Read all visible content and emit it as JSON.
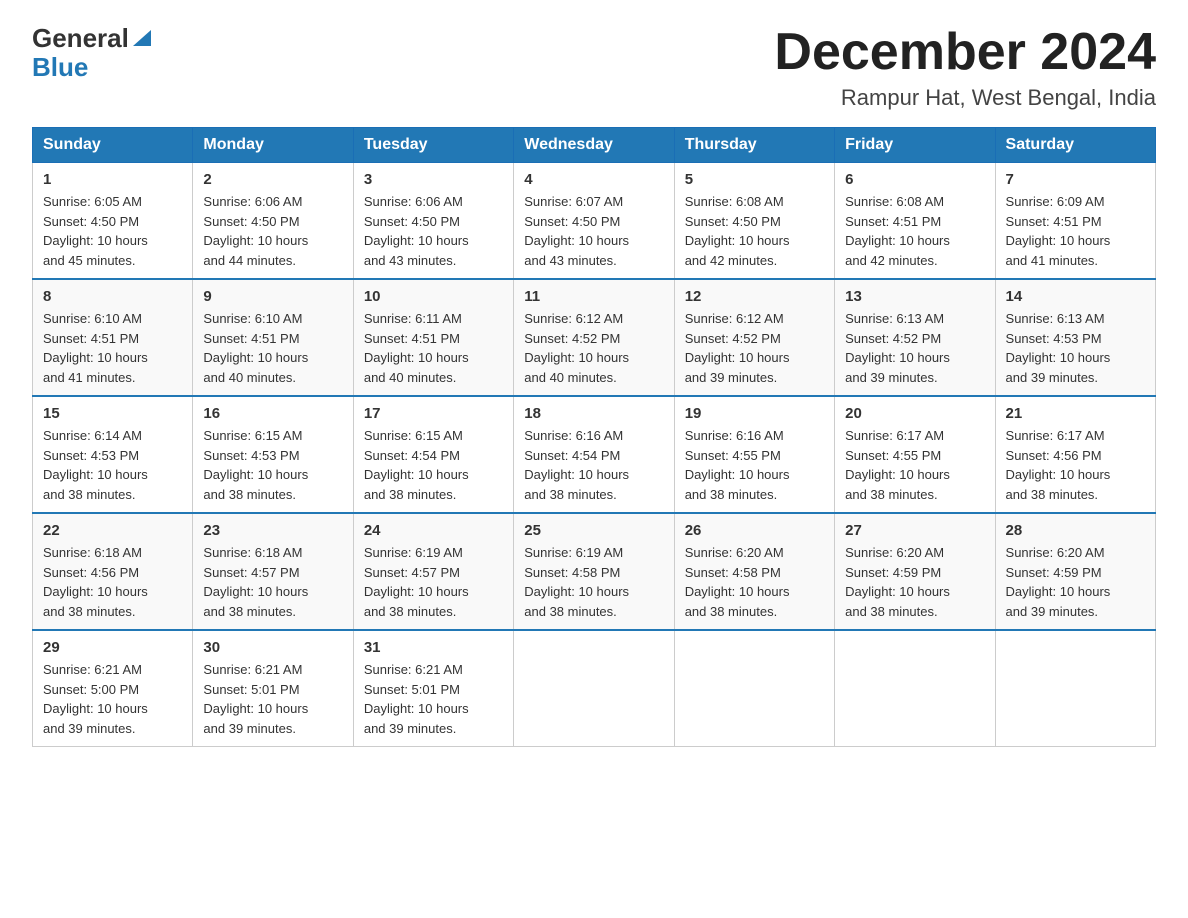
{
  "header": {
    "logo_line1": "General",
    "logo_line2": "Blue",
    "month_title": "December 2024",
    "location": "Rampur Hat, West Bengal, India"
  },
  "weekdays": [
    "Sunday",
    "Monday",
    "Tuesday",
    "Wednesday",
    "Thursday",
    "Friday",
    "Saturday"
  ],
  "weeks": [
    [
      {
        "day": "1",
        "sunrise": "6:05 AM",
        "sunset": "4:50 PM",
        "daylight": "10 hours and 45 minutes."
      },
      {
        "day": "2",
        "sunrise": "6:06 AM",
        "sunset": "4:50 PM",
        "daylight": "10 hours and 44 minutes."
      },
      {
        "day": "3",
        "sunrise": "6:06 AM",
        "sunset": "4:50 PM",
        "daylight": "10 hours and 43 minutes."
      },
      {
        "day": "4",
        "sunrise": "6:07 AM",
        "sunset": "4:50 PM",
        "daylight": "10 hours and 43 minutes."
      },
      {
        "day": "5",
        "sunrise": "6:08 AM",
        "sunset": "4:50 PM",
        "daylight": "10 hours and 42 minutes."
      },
      {
        "day": "6",
        "sunrise": "6:08 AM",
        "sunset": "4:51 PM",
        "daylight": "10 hours and 42 minutes."
      },
      {
        "day": "7",
        "sunrise": "6:09 AM",
        "sunset": "4:51 PM",
        "daylight": "10 hours and 41 minutes."
      }
    ],
    [
      {
        "day": "8",
        "sunrise": "6:10 AM",
        "sunset": "4:51 PM",
        "daylight": "10 hours and 41 minutes."
      },
      {
        "day": "9",
        "sunrise": "6:10 AM",
        "sunset": "4:51 PM",
        "daylight": "10 hours and 40 minutes."
      },
      {
        "day": "10",
        "sunrise": "6:11 AM",
        "sunset": "4:51 PM",
        "daylight": "10 hours and 40 minutes."
      },
      {
        "day": "11",
        "sunrise": "6:12 AM",
        "sunset": "4:52 PM",
        "daylight": "10 hours and 40 minutes."
      },
      {
        "day": "12",
        "sunrise": "6:12 AM",
        "sunset": "4:52 PM",
        "daylight": "10 hours and 39 minutes."
      },
      {
        "day": "13",
        "sunrise": "6:13 AM",
        "sunset": "4:52 PM",
        "daylight": "10 hours and 39 minutes."
      },
      {
        "day": "14",
        "sunrise": "6:13 AM",
        "sunset": "4:53 PM",
        "daylight": "10 hours and 39 minutes."
      }
    ],
    [
      {
        "day": "15",
        "sunrise": "6:14 AM",
        "sunset": "4:53 PM",
        "daylight": "10 hours and 38 minutes."
      },
      {
        "day": "16",
        "sunrise": "6:15 AM",
        "sunset": "4:53 PM",
        "daylight": "10 hours and 38 minutes."
      },
      {
        "day": "17",
        "sunrise": "6:15 AM",
        "sunset": "4:54 PM",
        "daylight": "10 hours and 38 minutes."
      },
      {
        "day": "18",
        "sunrise": "6:16 AM",
        "sunset": "4:54 PM",
        "daylight": "10 hours and 38 minutes."
      },
      {
        "day": "19",
        "sunrise": "6:16 AM",
        "sunset": "4:55 PM",
        "daylight": "10 hours and 38 minutes."
      },
      {
        "day": "20",
        "sunrise": "6:17 AM",
        "sunset": "4:55 PM",
        "daylight": "10 hours and 38 minutes."
      },
      {
        "day": "21",
        "sunrise": "6:17 AM",
        "sunset": "4:56 PM",
        "daylight": "10 hours and 38 minutes."
      }
    ],
    [
      {
        "day": "22",
        "sunrise": "6:18 AM",
        "sunset": "4:56 PM",
        "daylight": "10 hours and 38 minutes."
      },
      {
        "day": "23",
        "sunrise": "6:18 AM",
        "sunset": "4:57 PM",
        "daylight": "10 hours and 38 minutes."
      },
      {
        "day": "24",
        "sunrise": "6:19 AM",
        "sunset": "4:57 PM",
        "daylight": "10 hours and 38 minutes."
      },
      {
        "day": "25",
        "sunrise": "6:19 AM",
        "sunset": "4:58 PM",
        "daylight": "10 hours and 38 minutes."
      },
      {
        "day": "26",
        "sunrise": "6:20 AM",
        "sunset": "4:58 PM",
        "daylight": "10 hours and 38 minutes."
      },
      {
        "day": "27",
        "sunrise": "6:20 AM",
        "sunset": "4:59 PM",
        "daylight": "10 hours and 38 minutes."
      },
      {
        "day": "28",
        "sunrise": "6:20 AM",
        "sunset": "4:59 PM",
        "daylight": "10 hours and 39 minutes."
      }
    ],
    [
      {
        "day": "29",
        "sunrise": "6:21 AM",
        "sunset": "5:00 PM",
        "daylight": "10 hours and 39 minutes."
      },
      {
        "day": "30",
        "sunrise": "6:21 AM",
        "sunset": "5:01 PM",
        "daylight": "10 hours and 39 minutes."
      },
      {
        "day": "31",
        "sunrise": "6:21 AM",
        "sunset": "5:01 PM",
        "daylight": "10 hours and 39 minutes."
      },
      null,
      null,
      null,
      null
    ]
  ],
  "labels": {
    "sunrise": "Sunrise:",
    "sunset": "Sunset:",
    "daylight": "Daylight:"
  }
}
